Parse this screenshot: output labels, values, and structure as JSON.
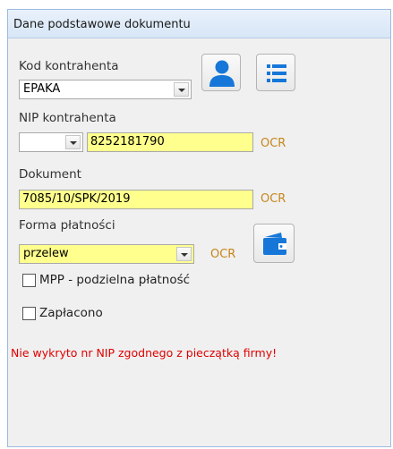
{
  "panel": {
    "title": "Dane podstawowe dokumentu"
  },
  "kontrahent": {
    "code_label": "Kod kontrahenta",
    "code_value": "EPAKA",
    "person_icon": "person-icon",
    "list_icon": "list-icon"
  },
  "nip": {
    "label": "NIP kontrahenta",
    "prefix_value": "",
    "value": "8252181790",
    "ocr_label": "OCR"
  },
  "dokument": {
    "label": "Dokument",
    "value": "7085/10/SPK/2019",
    "ocr_label": "OCR"
  },
  "platnosc": {
    "label": "Forma płatności",
    "value": "przelew",
    "ocr_label": "OCR",
    "wallet_icon": "wallet-icon"
  },
  "checkboxes": {
    "mpp_label": "MPP - podzielna płatność",
    "mpp_checked": false,
    "zaplacono_label": "Zapłacono",
    "zaplacono_checked": false
  },
  "error": {
    "message": "Nie wykryto nr NIP zgodnego z pieczątką firmy!"
  },
  "colors": {
    "highlight": "#ffff8d",
    "icon_blue": "#1677d9",
    "ocr": "#c7861c",
    "error": "#e00000"
  }
}
